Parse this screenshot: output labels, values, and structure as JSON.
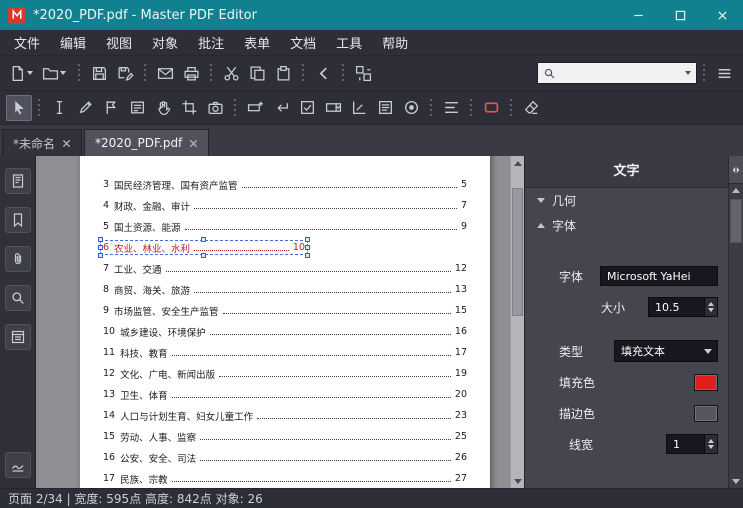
{
  "titlebar": {
    "title": "*2020_PDF.pdf - Master PDF Editor"
  },
  "menubar": {
    "items": [
      "文件",
      "编辑",
      "视图",
      "对象",
      "批注",
      "表单",
      "文档",
      "工具",
      "帮助"
    ]
  },
  "toolbar": {
    "search_value": ""
  },
  "tabs": {
    "items": [
      {
        "label": "*未命名",
        "active": false
      },
      {
        "label": "*2020_PDF.pdf",
        "active": true
      }
    ]
  },
  "doc": {
    "toc": [
      {
        "num": "3",
        "title": "国民经济管理、国有资产监管",
        "page": "5"
      },
      {
        "num": "4",
        "title": "财政、金融、审计",
        "page": "7"
      },
      {
        "num": "5",
        "title": "国土资源、能源",
        "page": "9"
      },
      {
        "num": "6",
        "title": "农业、林业、水利",
        "page": "10",
        "selected": true
      },
      {
        "num": "7",
        "title": "工业、交通",
        "page": "12"
      },
      {
        "num": "8",
        "title": "商贸、海关、旅游",
        "page": "13"
      },
      {
        "num": "9",
        "title": "市场监管、安全生产监管",
        "page": "15"
      },
      {
        "num": "10",
        "title": "城乡建设、环境保护",
        "page": "16"
      },
      {
        "num": "11",
        "title": "科技、教育",
        "page": "17"
      },
      {
        "num": "12",
        "title": "文化、广电、新闻出版",
        "page": "19"
      },
      {
        "num": "13",
        "title": "卫生、体育",
        "page": "20"
      },
      {
        "num": "14",
        "title": "人口与计划生育、妇女儿童工作",
        "page": "23"
      },
      {
        "num": "15",
        "title": "劳动、人事、监察",
        "page": "25"
      },
      {
        "num": "16",
        "title": "公安、安全、司法",
        "page": "26"
      },
      {
        "num": "17",
        "title": "民族、宗教",
        "page": "27"
      }
    ]
  },
  "panel": {
    "title": "文字",
    "sections": {
      "geometry": "几何",
      "font": "字体"
    },
    "font": {
      "family_label": "字体",
      "family_value": "Microsoft YaHei",
      "size_label": "大小",
      "size_value": "10.5",
      "type_label": "类型",
      "type_value": "填充文本",
      "fill_label": "填充色",
      "stroke_label": "描边色",
      "linewidth_label": "线宽",
      "linewidth_value": "1"
    },
    "colors": {
      "fill": "#e01f1f",
      "stroke": "#55555d"
    }
  },
  "statusbar": {
    "text": "页面 2/34 | 宽度: 595点 高度: 842点 对象: 26"
  },
  "colors": {
    "titlebar": "#11808f",
    "toolbar_bg": "#2e2e38",
    "selection_text_red": "#c22020",
    "selection_handle_blue": "#4a6fd4",
    "active_tool_red": "#e05252"
  }
}
